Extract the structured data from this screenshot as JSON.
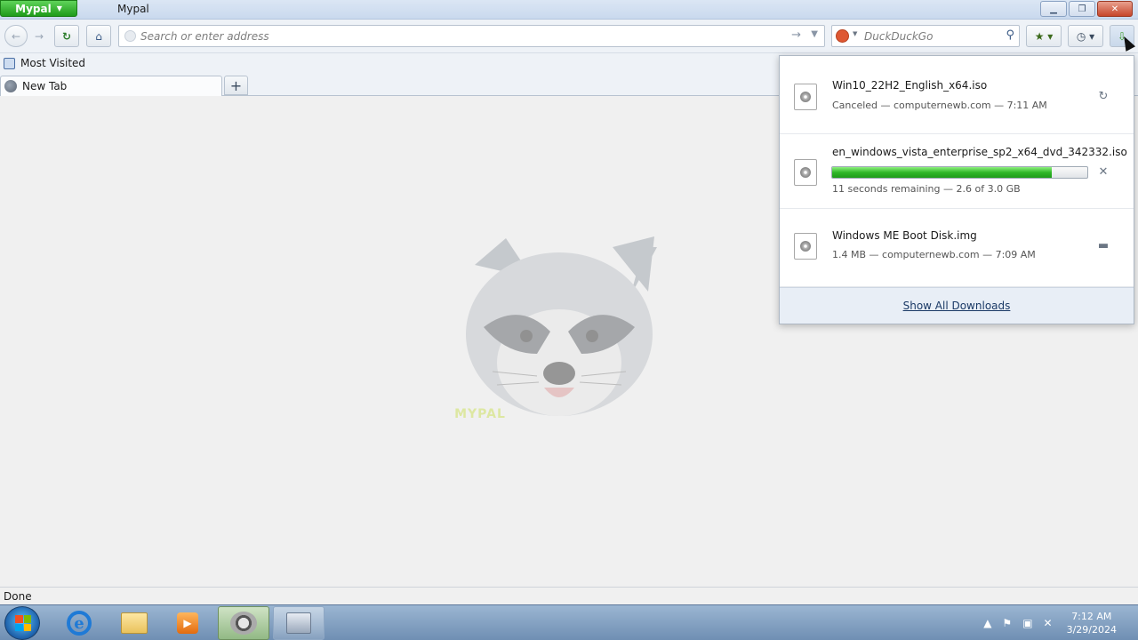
{
  "app": {
    "menu_label": "Mypal",
    "window_title": "Mypal"
  },
  "navbar": {
    "url_placeholder": "Search or enter address",
    "search_placeholder": "DuckDuckGo"
  },
  "bookmarks": {
    "items": [
      {
        "label": "Most Visited"
      }
    ]
  },
  "tabs": [
    {
      "label": "New Tab",
      "active": true
    }
  ],
  "content": {
    "logo_text": "MYPAL"
  },
  "downloads": {
    "items": [
      {
        "name": "Win10_22H2_English_x64.iso",
        "status": "Canceled — computernewb.com — 7:11 AM",
        "action_icon": "retry-icon"
      },
      {
        "name": "en_windows_vista_enterprise_sp2_x64_dvd_342332.iso",
        "status": "11 seconds remaining — 2.6 of 3.0 GB",
        "progress": 0.86,
        "action_icon": "cancel-icon"
      },
      {
        "name": "Windows ME Boot Disk.img",
        "status": "1.4 MB — computernewb.com — 7:09 AM",
        "action_icon": "folder-icon"
      }
    ],
    "show_all_label": "Show All Downloads"
  },
  "statusbar": {
    "text": "Done"
  },
  "taskbar": {
    "clock_time": "7:12 AM",
    "clock_date": "3/29/2024"
  },
  "colors": {
    "progress_green": "#2fb728",
    "app_button_green": "#1f9b1a",
    "taskbar_blue": "#6f8fb3"
  }
}
